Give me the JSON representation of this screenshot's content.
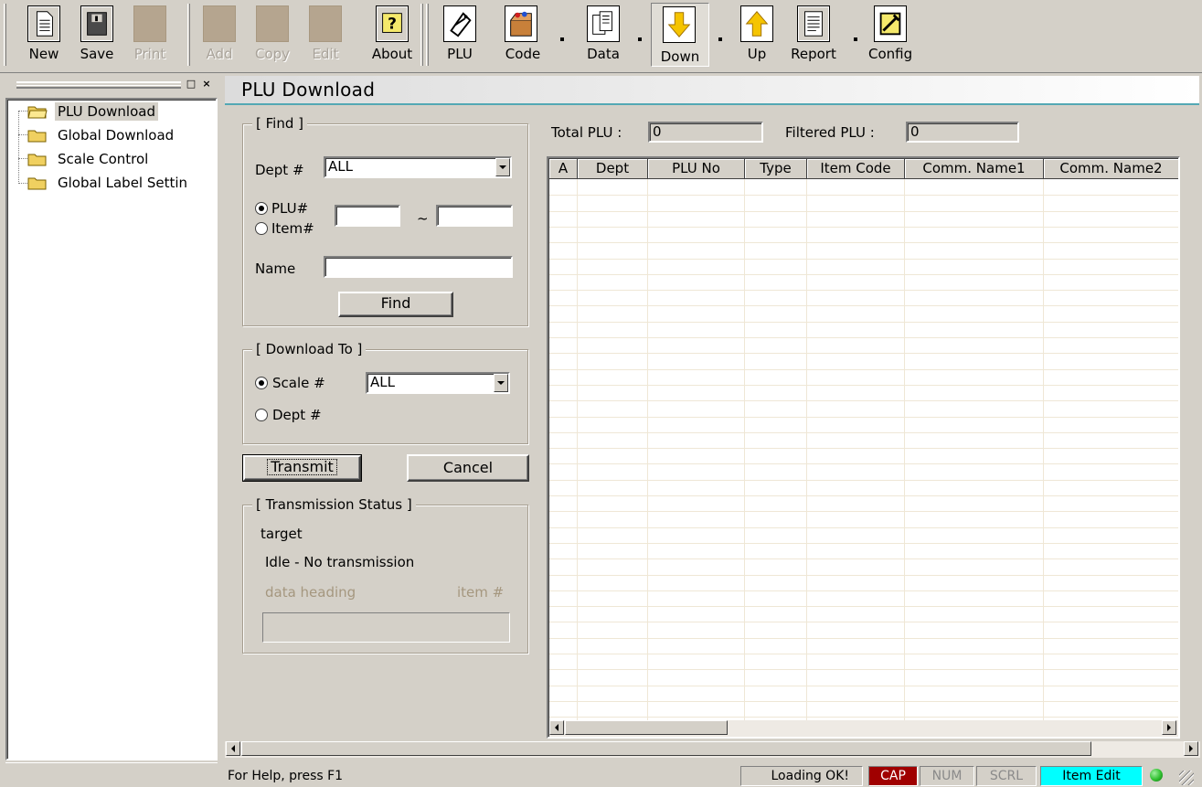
{
  "toolbar": {
    "buttons": [
      {
        "label": "New",
        "icon": "new-document-icon",
        "enabled": true
      },
      {
        "label": "Save",
        "icon": "save-disk-icon",
        "enabled": true
      },
      {
        "label": "Print",
        "icon": "print-icon",
        "enabled": false
      },
      {
        "label": "Add",
        "icon": "add-icon",
        "enabled": false
      },
      {
        "label": "Copy",
        "icon": "copy-icon",
        "enabled": false
      },
      {
        "label": "Edit",
        "icon": "edit-icon",
        "enabled": false
      },
      {
        "label": "About",
        "icon": "help-question-icon",
        "enabled": true
      },
      {
        "label": "PLU",
        "icon": "plu-tag-icon",
        "enabled": true
      },
      {
        "label": "Code",
        "icon": "code-box-icon",
        "enabled": true
      },
      {
        "label": "Data",
        "icon": "data-files-icon",
        "enabled": true
      },
      {
        "label": "Down",
        "icon": "down-arrow-icon",
        "enabled": true,
        "pressed": true
      },
      {
        "label": "Up",
        "icon": "up-arrow-icon",
        "enabled": true
      },
      {
        "label": "Report",
        "icon": "report-icon",
        "enabled": true
      },
      {
        "label": "Config",
        "icon": "config-icon",
        "enabled": true
      }
    ]
  },
  "tree": {
    "items": [
      {
        "label": "PLU Download",
        "selected": true
      },
      {
        "label": "Global Download",
        "selected": false
      },
      {
        "label": "Scale Control",
        "selected": false
      },
      {
        "label": "Global Label Settin",
        "selected": false
      }
    ]
  },
  "page": {
    "title": "PLU Download"
  },
  "find": {
    "legend": "[ Find ]",
    "dept_label": "Dept #",
    "dept_value": "ALL",
    "plu_radio": "PLU#",
    "item_radio": "Item#",
    "range_sep": "~",
    "range_from": "",
    "range_to": "",
    "name_label": "Name",
    "name_value": "",
    "find_button": "Find"
  },
  "download_to": {
    "legend": "[ Download To ]",
    "scale_radio": "Scale #",
    "scale_value": "ALL",
    "dept_radio": "Dept #"
  },
  "actions": {
    "transmit": "Transmit",
    "cancel": "Cancel"
  },
  "status": {
    "legend": "[ Transmission Status ]",
    "target": "target",
    "message": "Idle - No transmission",
    "data_heading": "data heading",
    "item_no": "item #"
  },
  "counts": {
    "total_label": "Total PLU :",
    "total_value": "0",
    "filtered_label": "Filtered PLU :",
    "filtered_value": "0"
  },
  "grid": {
    "columns": [
      "A",
      "Dept",
      "PLU No",
      "Type",
      "Item Code",
      "Comm. Name1",
      "Comm. Name2"
    ],
    "rows": []
  },
  "statusbar": {
    "help": "For Help, press F1",
    "loading": "Loading OK!",
    "cap": "CAP",
    "num": "NUM",
    "scrl": "SCRL",
    "mode": "Item Edit"
  },
  "colors": {
    "cap_bg": "#a00000",
    "mode_bg": "#00ffff",
    "indicator": "#2fbf2f",
    "title_rule": "#53a8b4"
  }
}
